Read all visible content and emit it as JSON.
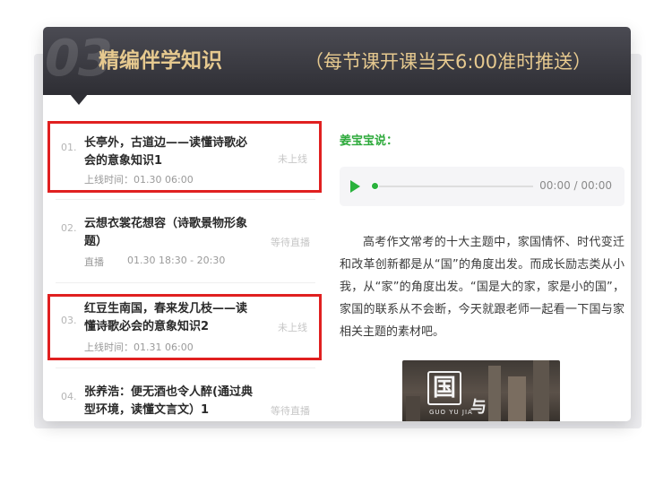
{
  "header": {
    "number": "03",
    "title": "精编伴学知识",
    "subtitle": "（每节课开课当天6:00准时推送）"
  },
  "lessons": [
    {
      "index": "01.",
      "title": "长亭外，古道边——读懂诗歌必会的意象知识1",
      "meta": "上线时间：01.30 06:00",
      "status": "未上线",
      "highlighted": true
    },
    {
      "index": "02.",
      "title": "云想衣裳花想容（诗歌景物形象题）",
      "meta_type": "直播",
      "meta_time": "01.30 18:30 - 20:30",
      "status": "等待直播",
      "highlighted": false
    },
    {
      "index": "03.",
      "title": "红豆生南国，春来发几枝——读懂诗歌必会的意象知识2",
      "meta": "上线时间：01.31 06:00",
      "status": "未上线",
      "highlighted": true
    },
    {
      "index": "04.",
      "title": "张养浩：便无酒也令人醉(通过典型环境，读懂文言文）1",
      "status": "等待直播",
      "highlighted": false
    }
  ],
  "content": {
    "author_label": "姜宝宝说：",
    "audio_time": "00:00 / 00:00",
    "paragraph": "高考作文常考的十大主题中，家国情怀、时代变迁和改革创新都是从“国”的角度出发。而成长励志类从小我，从“家”的角度出发。“国是大的家，家是小的国”，家国的联系从不会断，今天就跟老师一起看一下国与家相关主题的素材吧。",
    "image": {
      "char_main": "国",
      "caption": "GUO YU JIA",
      "char_second": "与"
    }
  },
  "colors": {
    "highlight_border": "#e02020",
    "accent_green": "#29b23c",
    "header_text": "#e6c98f"
  }
}
